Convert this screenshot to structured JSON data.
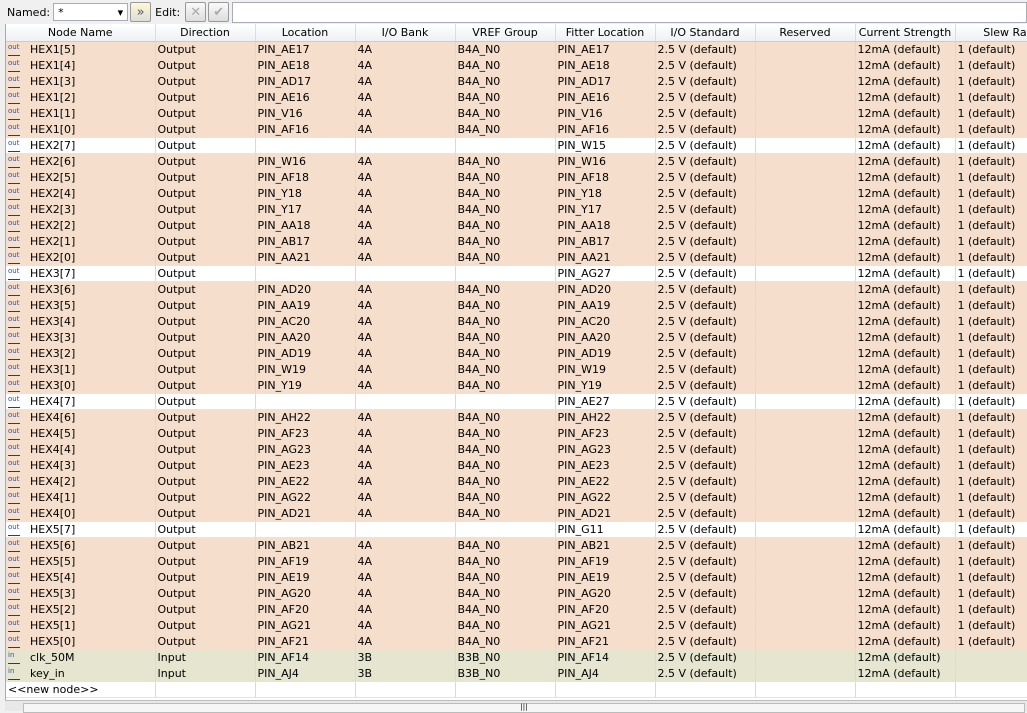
{
  "toolbar": {
    "named_label": "Named:",
    "named_value": "*",
    "edit_label": "Edit:"
  },
  "columns": [
    "Node Name",
    "Direction",
    "Location",
    "I/O Bank",
    "VREF Group",
    "Fitter Location",
    "I/O Standard",
    "Reserved",
    "Current Strength",
    "Slew Rate"
  ],
  "rows": [
    [
      "out",
      "HEX1[5]",
      "Output",
      "PIN_AE17",
      "4A",
      "B4A_N0",
      "PIN_AE17",
      "2.5 V (default)",
      "",
      "12mA (default)",
      "1 (default)"
    ],
    [
      "out",
      "HEX1[4]",
      "Output",
      "PIN_AE18",
      "4A",
      "B4A_N0",
      "PIN_AE18",
      "2.5 V (default)",
      "",
      "12mA (default)",
      "1 (default)"
    ],
    [
      "out",
      "HEX1[3]",
      "Output",
      "PIN_AD17",
      "4A",
      "B4A_N0",
      "PIN_AD17",
      "2.5 V (default)",
      "",
      "12mA (default)",
      "1 (default)"
    ],
    [
      "out",
      "HEX1[2]",
      "Output",
      "PIN_AE16",
      "4A",
      "B4A_N0",
      "PIN_AE16",
      "2.5 V (default)",
      "",
      "12mA (default)",
      "1 (default)"
    ],
    [
      "out",
      "HEX1[1]",
      "Output",
      "PIN_V16",
      "4A",
      "B4A_N0",
      "PIN_V16",
      "2.5 V (default)",
      "",
      "12mA (default)",
      "1 (default)"
    ],
    [
      "out",
      "HEX1[0]",
      "Output",
      "PIN_AF16",
      "4A",
      "B4A_N0",
      "PIN_AF16",
      "2.5 V (default)",
      "",
      "12mA (default)",
      "1 (default)"
    ],
    [
      "outw",
      "HEX2[7]",
      "Output",
      "",
      "",
      "",
      "PIN_W15",
      "2.5 V (default)",
      "",
      "12mA (default)",
      "1 (default)"
    ],
    [
      "out",
      "HEX2[6]",
      "Output",
      "PIN_W16",
      "4A",
      "B4A_N0",
      "PIN_W16",
      "2.5 V (default)",
      "",
      "12mA (default)",
      "1 (default)"
    ],
    [
      "out",
      "HEX2[5]",
      "Output",
      "PIN_AF18",
      "4A",
      "B4A_N0",
      "PIN_AF18",
      "2.5 V (default)",
      "",
      "12mA (default)",
      "1 (default)"
    ],
    [
      "out",
      "HEX2[4]",
      "Output",
      "PIN_Y18",
      "4A",
      "B4A_N0",
      "PIN_Y18",
      "2.5 V (default)",
      "",
      "12mA (default)",
      "1 (default)"
    ],
    [
      "out",
      "HEX2[3]",
      "Output",
      "PIN_Y17",
      "4A",
      "B4A_N0",
      "PIN_Y17",
      "2.5 V (default)",
      "",
      "12mA (default)",
      "1 (default)"
    ],
    [
      "out",
      "HEX2[2]",
      "Output",
      "PIN_AA18",
      "4A",
      "B4A_N0",
      "PIN_AA18",
      "2.5 V (default)",
      "",
      "12mA (default)",
      "1 (default)"
    ],
    [
      "out",
      "HEX2[1]",
      "Output",
      "PIN_AB17",
      "4A",
      "B4A_N0",
      "PIN_AB17",
      "2.5 V (default)",
      "",
      "12mA (default)",
      "1 (default)"
    ],
    [
      "out",
      "HEX2[0]",
      "Output",
      "PIN_AA21",
      "4A",
      "B4A_N0",
      "PIN_AA21",
      "2.5 V (default)",
      "",
      "12mA (default)",
      "1 (default)"
    ],
    [
      "outw",
      "HEX3[7]",
      "Output",
      "",
      "",
      "",
      "PIN_AG27",
      "2.5 V (default)",
      "",
      "12mA (default)",
      "1 (default)"
    ],
    [
      "out",
      "HEX3[6]",
      "Output",
      "PIN_AD20",
      "4A",
      "B4A_N0",
      "PIN_AD20",
      "2.5 V (default)",
      "",
      "12mA (default)",
      "1 (default)"
    ],
    [
      "out",
      "HEX3[5]",
      "Output",
      "PIN_AA19",
      "4A",
      "B4A_N0",
      "PIN_AA19",
      "2.5 V (default)",
      "",
      "12mA (default)",
      "1 (default)"
    ],
    [
      "out",
      "HEX3[4]",
      "Output",
      "PIN_AC20",
      "4A",
      "B4A_N0",
      "PIN_AC20",
      "2.5 V (default)",
      "",
      "12mA (default)",
      "1 (default)"
    ],
    [
      "out",
      "HEX3[3]",
      "Output",
      "PIN_AA20",
      "4A",
      "B4A_N0",
      "PIN_AA20",
      "2.5 V (default)",
      "",
      "12mA (default)",
      "1 (default)"
    ],
    [
      "out",
      "HEX3[2]",
      "Output",
      "PIN_AD19",
      "4A",
      "B4A_N0",
      "PIN_AD19",
      "2.5 V (default)",
      "",
      "12mA (default)",
      "1 (default)"
    ],
    [
      "out",
      "HEX3[1]",
      "Output",
      "PIN_W19",
      "4A",
      "B4A_N0",
      "PIN_W19",
      "2.5 V (default)",
      "",
      "12mA (default)",
      "1 (default)"
    ],
    [
      "out",
      "HEX3[0]",
      "Output",
      "PIN_Y19",
      "4A",
      "B4A_N0",
      "PIN_Y19",
      "2.5 V (default)",
      "",
      "12mA (default)",
      "1 (default)"
    ],
    [
      "outw",
      "HEX4[7]",
      "Output",
      "",
      "",
      "",
      "PIN_AE27",
      "2.5 V (default)",
      "",
      "12mA (default)",
      "1 (default)"
    ],
    [
      "out",
      "HEX4[6]",
      "Output",
      "PIN_AH22",
      "4A",
      "B4A_N0",
      "PIN_AH22",
      "2.5 V (default)",
      "",
      "12mA (default)",
      "1 (default)"
    ],
    [
      "out",
      "HEX4[5]",
      "Output",
      "PIN_AF23",
      "4A",
      "B4A_N0",
      "PIN_AF23",
      "2.5 V (default)",
      "",
      "12mA (default)",
      "1 (default)"
    ],
    [
      "out",
      "HEX4[4]",
      "Output",
      "PIN_AG23",
      "4A",
      "B4A_N0",
      "PIN_AG23",
      "2.5 V (default)",
      "",
      "12mA (default)",
      "1 (default)"
    ],
    [
      "out",
      "HEX4[3]",
      "Output",
      "PIN_AE23",
      "4A",
      "B4A_N0",
      "PIN_AE23",
      "2.5 V (default)",
      "",
      "12mA (default)",
      "1 (default)"
    ],
    [
      "out",
      "HEX4[2]",
      "Output",
      "PIN_AE22",
      "4A",
      "B4A_N0",
      "PIN_AE22",
      "2.5 V (default)",
      "",
      "12mA (default)",
      "1 (default)"
    ],
    [
      "out",
      "HEX4[1]",
      "Output",
      "PIN_AG22",
      "4A",
      "B4A_N0",
      "PIN_AG22",
      "2.5 V (default)",
      "",
      "12mA (default)",
      "1 (default)"
    ],
    [
      "out",
      "HEX4[0]",
      "Output",
      "PIN_AD21",
      "4A",
      "B4A_N0",
      "PIN_AD21",
      "2.5 V (default)",
      "",
      "12mA (default)",
      "1 (default)"
    ],
    [
      "outw",
      "HEX5[7]",
      "Output",
      "",
      "",
      "",
      "PIN_G11",
      "2.5 V (default)",
      "",
      "12mA (default)",
      "1 (default)"
    ],
    [
      "out",
      "HEX5[6]",
      "Output",
      "PIN_AB21",
      "4A",
      "B4A_N0",
      "PIN_AB21",
      "2.5 V (default)",
      "",
      "12mA (default)",
      "1 (default)"
    ],
    [
      "out",
      "HEX5[5]",
      "Output",
      "PIN_AF19",
      "4A",
      "B4A_N0",
      "PIN_AF19",
      "2.5 V (default)",
      "",
      "12mA (default)",
      "1 (default)"
    ],
    [
      "out",
      "HEX5[4]",
      "Output",
      "PIN_AE19",
      "4A",
      "B4A_N0",
      "PIN_AE19",
      "2.5 V (default)",
      "",
      "12mA (default)",
      "1 (default)"
    ],
    [
      "out",
      "HEX5[3]",
      "Output",
      "PIN_AG20",
      "4A",
      "B4A_N0",
      "PIN_AG20",
      "2.5 V (default)",
      "",
      "12mA (default)",
      "1 (default)"
    ],
    [
      "out",
      "HEX5[2]",
      "Output",
      "PIN_AF20",
      "4A",
      "B4A_N0",
      "PIN_AF20",
      "2.5 V (default)",
      "",
      "12mA (default)",
      "1 (default)"
    ],
    [
      "out",
      "HEX5[1]",
      "Output",
      "PIN_AG21",
      "4A",
      "B4A_N0",
      "PIN_AG21",
      "2.5 V (default)",
      "",
      "12mA (default)",
      "1 (default)"
    ],
    [
      "out",
      "HEX5[0]",
      "Output",
      "PIN_AF21",
      "4A",
      "B4A_N0",
      "PIN_AF21",
      "2.5 V (default)",
      "",
      "12mA (default)",
      "1 (default)"
    ],
    [
      "in",
      "clk_50M",
      "Input",
      "PIN_AF14",
      "3B",
      "B3B_N0",
      "PIN_AF14",
      "2.5 V (default)",
      "",
      "12mA (default)",
      ""
    ],
    [
      "in",
      "key_in",
      "Input",
      "PIN_AJ4",
      "3B",
      "B3B_N0",
      "PIN_AJ4",
      "2.5 V (default)",
      "",
      "12mA (default)",
      ""
    ]
  ],
  "new_node": "<<new node>>",
  "colors": {
    "output_row": "#f5dfcc",
    "input_row": "#e5e5d0",
    "unassigned_row": "#ffffff"
  }
}
